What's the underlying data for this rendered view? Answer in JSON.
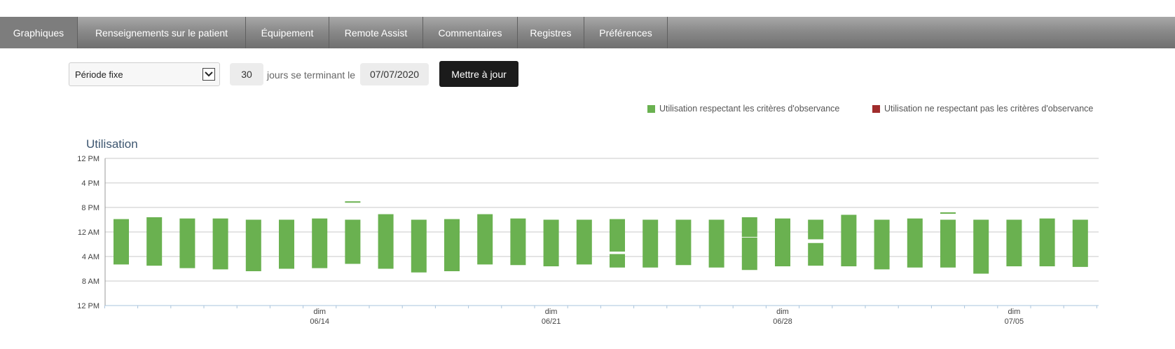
{
  "tabs": [
    {
      "label": "Graphiques",
      "active": true
    },
    {
      "label": "Renseignements sur le patient",
      "active": false
    },
    {
      "label": "Équipement",
      "active": false
    },
    {
      "label": "Remote Assist",
      "active": false
    },
    {
      "label": "Commentaires",
      "active": false
    },
    {
      "label": "Registres",
      "active": false
    },
    {
      "label": "Préférences",
      "active": false
    }
  ],
  "controls": {
    "period_select": "Période fixe",
    "days_value": "30",
    "days_label": "jours se terminant le",
    "end_date": "07/07/2020",
    "update_label": "Mettre à jour"
  },
  "legend": [
    {
      "label": "Utilisation respectant les critères d'observance",
      "color": "#6ab150"
    },
    {
      "label": "Utilisation ne respectant pas les critères d'observance",
      "color": "#a02c2c"
    }
  ],
  "colors": {
    "compliant": "#6ab150",
    "noncompliant": "#a02c2c"
  },
  "chart_title": "Utilisation",
  "chart_data": {
    "type": "bar",
    "title": "Utilisation",
    "y_unit": "hours since noon (0 = 12 PM, 24 = next 12 PM)",
    "ylim": [
      0,
      24
    ],
    "y_ticks": [
      {
        "value": 0,
        "label": "12 PM"
      },
      {
        "value": 4,
        "label": "4 PM"
      },
      {
        "value": 8,
        "label": "8 PM"
      },
      {
        "value": 12,
        "label": "12 AM"
      },
      {
        "value": 16,
        "label": "4 AM"
      },
      {
        "value": 20,
        "label": "8 AM"
      },
      {
        "value": 24,
        "label": "12 PM"
      }
    ],
    "x_labels": [
      {
        "day_index": 6,
        "line1": "dim",
        "line2": "06/14"
      },
      {
        "day_index": 13,
        "line1": "dim",
        "line2": "06/21"
      },
      {
        "day_index": 20,
        "line1": "dim",
        "line2": "06/28"
      },
      {
        "day_index": 27,
        "line1": "dim",
        "line2": "07/05"
      }
    ],
    "days": [
      {
        "segments": [
          [
            9.9,
            17.3
          ]
        ]
      },
      {
        "segments": [
          [
            9.6,
            17.5
          ]
        ]
      },
      {
        "segments": [
          [
            9.8,
            17.9
          ]
        ]
      },
      {
        "segments": [
          [
            9.8,
            18.1
          ]
        ]
      },
      {
        "segments": [
          [
            10.0,
            18.4
          ]
        ]
      },
      {
        "segments": [
          [
            10.0,
            18.0
          ]
        ]
      },
      {
        "segments": [
          [
            9.8,
            17.9
          ]
        ]
      },
      {
        "segments": [
          [
            7.0,
            7.2
          ],
          [
            10.0,
            17.2
          ]
        ]
      },
      {
        "segments": [
          [
            9.1,
            18.0
          ]
        ]
      },
      {
        "segments": [
          [
            10.0,
            18.6
          ]
        ]
      },
      {
        "segments": [
          [
            9.9,
            18.4
          ]
        ]
      },
      {
        "segments": [
          [
            9.1,
            17.3
          ]
        ]
      },
      {
        "segments": [
          [
            9.8,
            17.4
          ]
        ]
      },
      {
        "segments": [
          [
            10.0,
            17.6
          ]
        ]
      },
      {
        "segments": [
          [
            10.0,
            17.3
          ]
        ]
      },
      {
        "segments": [
          [
            9.9,
            15.2
          ],
          [
            15.6,
            17.8
          ]
        ]
      },
      {
        "segments": [
          [
            10.0,
            17.8
          ]
        ]
      },
      {
        "segments": [
          [
            10.0,
            17.4
          ]
        ]
      },
      {
        "segments": [
          [
            10.0,
            17.8
          ]
        ]
      },
      {
        "segments": [
          [
            9.6,
            12.8
          ],
          [
            12.9,
            18.2
          ]
        ]
      },
      {
        "segments": [
          [
            9.8,
            17.6
          ]
        ]
      },
      {
        "segments": [
          [
            10.0,
            13.2
          ],
          [
            13.8,
            17.5
          ]
        ]
      },
      {
        "segments": [
          [
            9.2,
            17.6
          ]
        ]
      },
      {
        "segments": [
          [
            10.0,
            18.1
          ]
        ]
      },
      {
        "segments": [
          [
            9.8,
            17.8
          ]
        ]
      },
      {
        "segments": [
          [
            8.8,
            9.0
          ],
          [
            10.0,
            17.8
          ]
        ]
      },
      {
        "segments": [
          [
            10.0,
            18.8
          ]
        ]
      },
      {
        "segments": [
          [
            10.0,
            17.6
          ]
        ]
      },
      {
        "segments": [
          [
            9.8,
            17.6
          ]
        ]
      },
      {
        "segments": [
          [
            10.0,
            17.7
          ]
        ]
      }
    ]
  }
}
